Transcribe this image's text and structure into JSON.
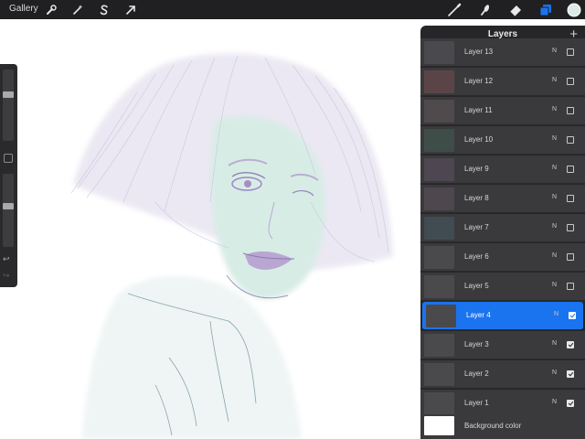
{
  "topbar": {
    "gallery_label": "Gallery",
    "left_tools": [
      {
        "name": "actions-wrench-icon"
      },
      {
        "name": "adjustments-magic-wand-icon"
      },
      {
        "name": "selection-s-icon"
      },
      {
        "name": "transform-arrow-icon"
      }
    ],
    "right_tools": [
      {
        "name": "brush-icon"
      },
      {
        "name": "smudge-icon"
      },
      {
        "name": "eraser-icon"
      },
      {
        "name": "layers-icon",
        "active": true
      }
    ],
    "active_color": "#dde9e6",
    "accent": "#1a74ef"
  },
  "sidebar": {
    "brush_size_level": 0.45,
    "opacity_level": 0.55,
    "undo_icon": "undo-arrow-icon",
    "redo_icon": "redo-arrow-icon"
  },
  "layers_panel": {
    "title": "Layers",
    "add_icon": "plus-icon",
    "layers": [
      {
        "name": "Layer 13",
        "blend": "N",
        "visible": false,
        "selected": false,
        "thumb_color": "#4a4a4e"
      },
      {
        "name": "Layer 12",
        "blend": "N",
        "visible": false,
        "selected": false,
        "thumb_color": "#5b4448"
      },
      {
        "name": "Layer 11",
        "blend": "N",
        "visible": false,
        "selected": false,
        "thumb_color": "#4f4a4c"
      },
      {
        "name": "Layer 10",
        "blend": "N",
        "visible": false,
        "selected": false,
        "thumb_color": "#3f4d48"
      },
      {
        "name": "Layer 9",
        "blend": "N",
        "visible": false,
        "selected": false,
        "thumb_color": "#4e4650"
      },
      {
        "name": "Layer 8",
        "blend": "N",
        "visible": false,
        "selected": false,
        "thumb_color": "#4f474e"
      },
      {
        "name": "Layer 7",
        "blend": "N",
        "visible": false,
        "selected": false,
        "thumb_color": "#414b52"
      },
      {
        "name": "Layer 6",
        "blend": "N",
        "visible": false,
        "selected": false,
        "thumb_color": "#4a4a4d"
      },
      {
        "name": "Layer 5",
        "blend": "N",
        "visible": false,
        "selected": false,
        "thumb_color": "#4a4a4d"
      },
      {
        "name": "Layer 4",
        "blend": "N",
        "visible": true,
        "selected": true,
        "thumb_color": "#4a4a4d"
      },
      {
        "name": "Layer 3",
        "blend": "N",
        "visible": true,
        "selected": false,
        "thumb_color": "#4a4a4d"
      },
      {
        "name": "Layer 2",
        "blend": "N",
        "visible": true,
        "selected": false,
        "thumb_color": "#4a4a4d"
      },
      {
        "name": "Layer 1",
        "blend": "N",
        "visible": true,
        "selected": false,
        "thumb_color": "#4a4a4d"
      }
    ],
    "background": {
      "name": "Background color",
      "visible": true,
      "thumb_color": "#ffffff"
    }
  }
}
